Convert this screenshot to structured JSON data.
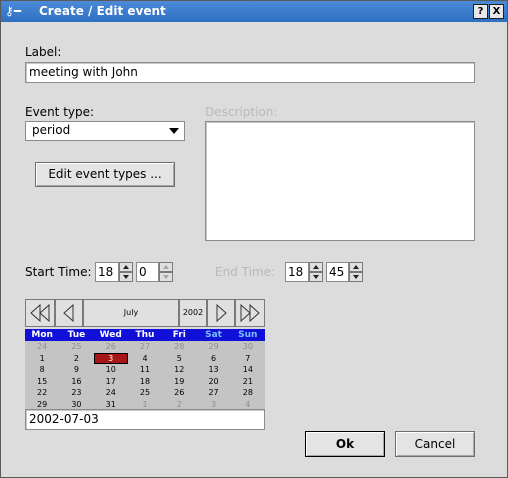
{
  "window": {
    "title": "Create / Edit event",
    "help_button": "?",
    "close_button": "X"
  },
  "label_section": {
    "label": "Label:",
    "value": "meeting with John"
  },
  "event_type": {
    "label": "Event type:",
    "selected": "period",
    "edit_button": "Edit event types ..."
  },
  "description": {
    "label": "Description:",
    "value": ""
  },
  "start_time": {
    "label": "Start Time:",
    "hour": "18",
    "minute": "0"
  },
  "end_time": {
    "label": "End Time:",
    "hour": "18",
    "minute": "45"
  },
  "calendar": {
    "month": "July",
    "year": "2002",
    "weekday_headers": [
      "Mon",
      "Tue",
      "Wed",
      "Thu",
      "Fri",
      "Sat",
      "Sun"
    ],
    "weeks": [
      [
        "24",
        "25",
        "26",
        "27",
        "28",
        "29",
        "30"
      ],
      [
        "1",
        "2",
        "3",
        "4",
        "5",
        "6",
        "7"
      ],
      [
        "8",
        "9",
        "10",
        "11",
        "12",
        "13",
        "14"
      ],
      [
        "15",
        "16",
        "17",
        "18",
        "19",
        "20",
        "21"
      ],
      [
        "22",
        "23",
        "24",
        "25",
        "26",
        "27",
        "28"
      ],
      [
        "29",
        "30",
        "31",
        "1",
        "2",
        "3",
        "4"
      ]
    ],
    "selected_day": "3",
    "date_field": "2002-07-03",
    "colors": {
      "header_bg": "#1010d8",
      "weekend_header": "#7ac0ff",
      "selected_bg": "#a51616"
    }
  },
  "buttons": {
    "ok": "Ok",
    "cancel": "Cancel"
  },
  "icons": {
    "window_menu": "key-icon",
    "nav_first": "double-left-arrow-icon",
    "nav_prev": "left-arrow-icon",
    "nav_next": "right-arrow-icon",
    "nav_last": "double-right-arrow-icon"
  }
}
